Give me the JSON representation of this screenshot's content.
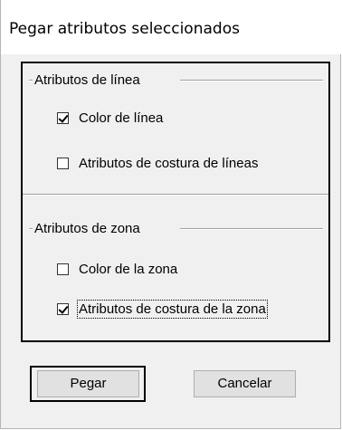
{
  "window": {
    "title": "Pegar atributos seleccionados"
  },
  "line_group": {
    "label": "Atributos de línea",
    "options": [
      {
        "label": "Color de línea",
        "checked": true
      },
      {
        "label": "Atributos de costura de líneas",
        "checked": false
      }
    ]
  },
  "zone_group": {
    "label": "Atributos de zona",
    "options": [
      {
        "label": "Color de la zona",
        "checked": false
      },
      {
        "label": "Atributos de costura de la zona",
        "checked": true
      }
    ]
  },
  "buttons": {
    "paste_label": "Pegar",
    "cancel_label": "Cancelar"
  }
}
